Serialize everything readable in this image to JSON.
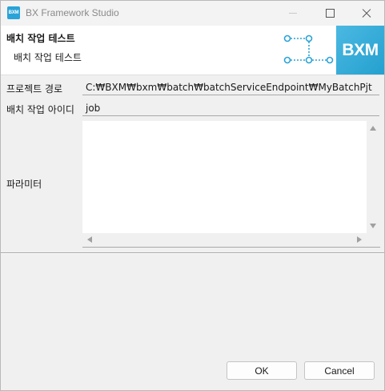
{
  "window": {
    "title": "BX Framework Studio",
    "app_icon_text": "BXM"
  },
  "header": {
    "title": "배치 작업 테스트",
    "description": "배치 작업 테스트",
    "logo_text": "BXM",
    "accent_color": "#2aa3d8"
  },
  "form": {
    "project_path_label": "프로젝트 경로",
    "project_path_value": "C:₩BXM₩bxm₩batch₩batchServiceEndpoint₩MyBatchPjt",
    "batch_job_id_label": "배치 작업 아이디",
    "batch_job_id_value": "job",
    "parameter_label": "파라미터",
    "parameter_value": ""
  },
  "buttons": {
    "ok": "OK",
    "cancel": "Cancel"
  }
}
